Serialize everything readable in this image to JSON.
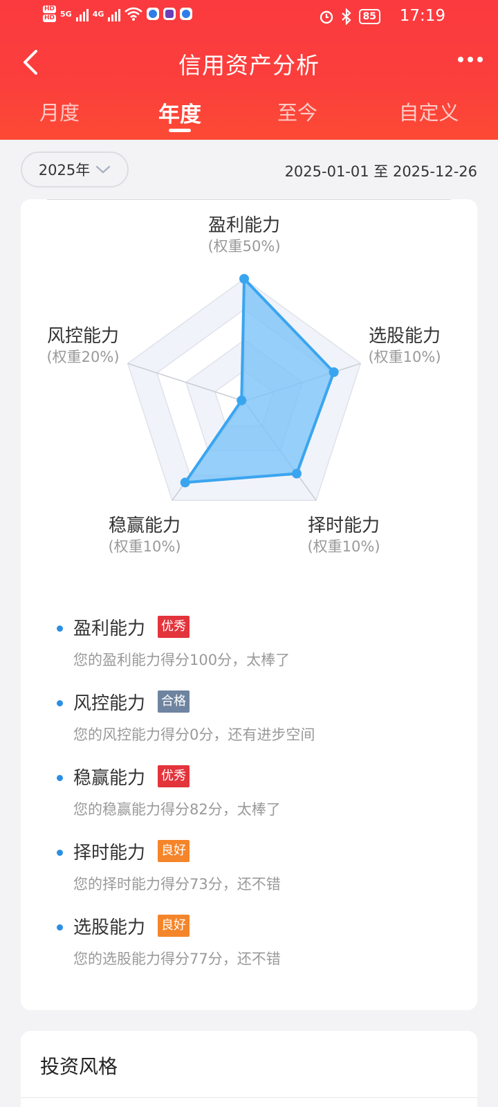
{
  "status": {
    "hd1": "HD",
    "hd2": "HD",
    "net1": "5G",
    "net2": "4G",
    "battery": "85",
    "time": "17:19"
  },
  "nav": {
    "title": "信用资产分析"
  },
  "tabs": [
    {
      "label": "月度"
    },
    {
      "label": "年度"
    },
    {
      "label": "至今"
    },
    {
      "label": "自定义"
    }
  ],
  "filter": {
    "year": "2025年",
    "range": "2025-01-01 至 2025-12-26"
  },
  "chart_data": {
    "type": "radar",
    "axes": [
      {
        "name": "盈利能力",
        "weight": "(权重50%)",
        "value": 100
      },
      {
        "name": "选股能力",
        "weight": "(权重10%)",
        "value": 77
      },
      {
        "name": "择时能力",
        "weight": "(权重10%)",
        "value": 73
      },
      {
        "name": "稳赢能力",
        "weight": "(权重10%)",
        "value": 82
      },
      {
        "name": "风控能力",
        "weight": "(权重20%)",
        "value": 0
      }
    ],
    "range": [
      0,
      100
    ],
    "rings": 4,
    "fill_color": "#7cc3f8",
    "line_color": "#3aa5ef"
  },
  "scores": [
    {
      "name": "盈利能力",
      "badge": "优秀",
      "badge_color": "#e3343c",
      "desc": "您的盈利能力得分100分，太棒了"
    },
    {
      "name": "风控能力",
      "badge": "合格",
      "badge_color": "#6e84a0",
      "desc": "您的风控能力得分0分，还有进步空间"
    },
    {
      "name": "稳赢能力",
      "badge": "优秀",
      "badge_color": "#e3343c",
      "desc": "您的稳赢能力得分82分，太棒了"
    },
    {
      "name": "择时能力",
      "badge": "良好",
      "badge_color": "#f5852a",
      "desc": "您的择时能力得分73分，还不错"
    },
    {
      "name": "选股能力",
      "badge": "良好",
      "badge_color": "#f5852a",
      "desc": "您的选股能力得分77分，还不错"
    }
  ],
  "section2": {
    "title": "投资风格"
  }
}
